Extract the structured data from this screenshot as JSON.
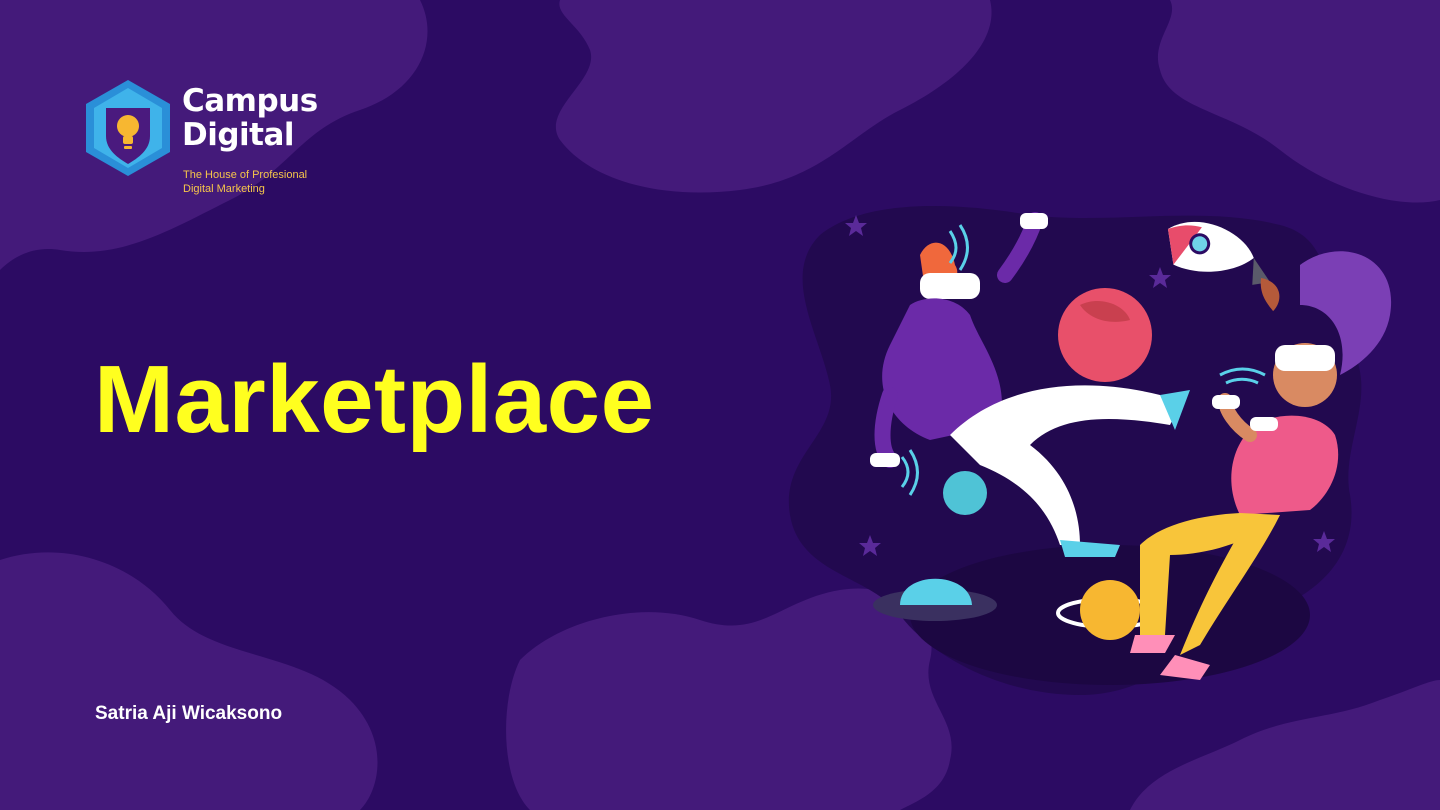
{
  "logo": {
    "name_line1": "Campus",
    "name_line2": "Digital",
    "tagline_line1": "The House of Profesional",
    "tagline_line2": "Digital Marketing",
    "icon": "lightbulb-shield-icon"
  },
  "slide": {
    "title": "Marketplace",
    "author": "Satria Aji Wicaksono"
  },
  "illustration": {
    "subject": "two people with vr headsets and controllers floating among planets and a rocket"
  },
  "colors": {
    "background": "#2c0b63",
    "blob": "#441a7a",
    "title": "#ffff1f",
    "author": "#ffffff",
    "tagline": "#f7c64a"
  }
}
